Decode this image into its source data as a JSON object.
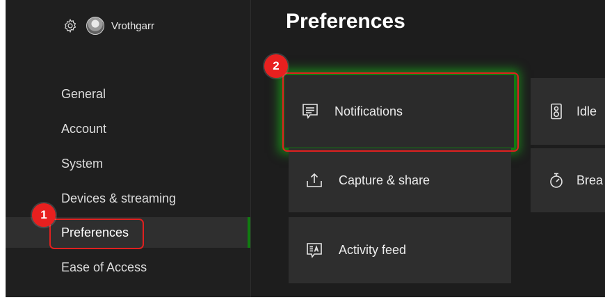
{
  "user": {
    "gamertag": "Vrothgarr"
  },
  "nav": {
    "items": [
      {
        "label": "General"
      },
      {
        "label": "Account"
      },
      {
        "label": "System"
      },
      {
        "label": "Devices & streaming"
      },
      {
        "label": "Preferences",
        "selected": true
      },
      {
        "label": "Ease of Access"
      }
    ]
  },
  "main": {
    "title": "Preferences",
    "tiles": [
      {
        "label": "Notifications",
        "icon": "notifications-icon",
        "focused": true
      },
      {
        "label": "Capture & share",
        "icon": "capture-share-icon"
      },
      {
        "label": "Activity feed",
        "icon": "activity-feed-icon"
      },
      {
        "label": "Idle",
        "icon": "idle-options-icon"
      },
      {
        "label": "Brea",
        "icon": "timer-icon"
      }
    ]
  },
  "annotations": {
    "step1": "1",
    "step2": "2"
  },
  "colors": {
    "background": "#1d1d1d",
    "sidebar": "#1f1f1f",
    "tile": "#2e2e2e",
    "accent_green": "#107c10",
    "callout_red": "#e0201f"
  }
}
